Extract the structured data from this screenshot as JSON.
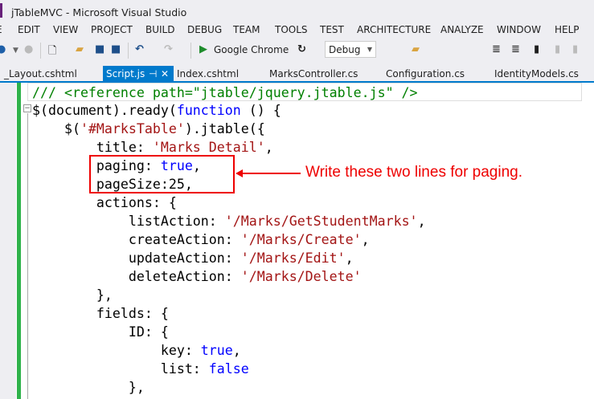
{
  "window": {
    "title": "jTableMVC - Microsoft Visual Studio"
  },
  "menu": [
    "EDIT",
    "VIEW",
    "PROJECT",
    "BUILD",
    "DEBUG",
    "TEAM",
    "TOOLS",
    "TEST",
    "ARCHITECTURE",
    "ANALYZE",
    "WINDOW",
    "HELP"
  ],
  "toolbar": {
    "run_target": "Google Chrome",
    "configuration": "Debug"
  },
  "tabs": [
    "_Layout.cshtml",
    "Script.js",
    "Index.cshtml",
    "MarksController.cs",
    "Configuration.cs",
    "IdentityModels.cs"
  ],
  "active_tab": "Script.js",
  "code": [
    [
      [
        "c",
        "/// <reference path=\"jtable/jquery.jtable.js\" />"
      ]
    ],
    [
      [
        "",
        "$(document).ready("
      ],
      [
        "k",
        "function"
      ],
      [
        "",
        " () {"
      ]
    ],
    [
      [
        "",
        "    $("
      ],
      [
        "s",
        "'#MarksTable'"
      ],
      [
        "",
        ").jtable({"
      ]
    ],
    [
      [
        "",
        "        title: "
      ],
      [
        "s",
        "'Marks Detail'"
      ],
      [
        "",
        ","
      ]
    ],
    [
      [
        "",
        "        paging: "
      ],
      [
        "k",
        "true"
      ],
      [
        "",
        ","
      ]
    ],
    [
      [
        "",
        "        pageSize:25,"
      ]
    ],
    [
      [
        "",
        "        actions: {"
      ]
    ],
    [
      [
        "",
        "            listAction: "
      ],
      [
        "s",
        "'/Marks/GetStudentMarks'"
      ],
      [
        "",
        ","
      ]
    ],
    [
      [
        "",
        "            createAction: "
      ],
      [
        "s",
        "'/Marks/Create'"
      ],
      [
        "",
        ","
      ]
    ],
    [
      [
        "",
        "            updateAction: "
      ],
      [
        "s",
        "'/Marks/Edit'"
      ],
      [
        "",
        ","
      ]
    ],
    [
      [
        "",
        "            deleteAction: "
      ],
      [
        "s",
        "'/Marks/Delete'"
      ]
    ],
    [
      [
        "",
        "        },"
      ]
    ],
    [
      [
        "",
        "        fields: {"
      ]
    ],
    [
      [
        "",
        "            ID: {"
      ]
    ],
    [
      [
        "",
        "                key: "
      ],
      [
        "k",
        "true"
      ],
      [
        "",
        ","
      ]
    ],
    [
      [
        "",
        "                list: "
      ],
      [
        "k",
        "false"
      ]
    ],
    [
      [
        "",
        "            },"
      ]
    ]
  ],
  "annotation": "Write these two lines for paging."
}
